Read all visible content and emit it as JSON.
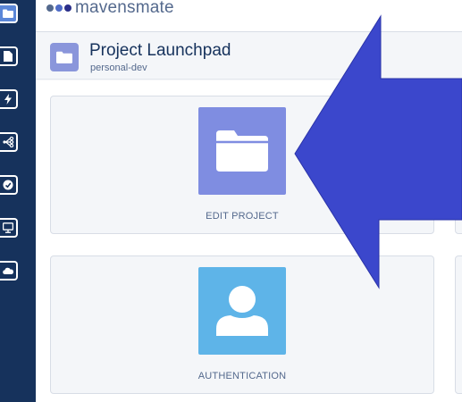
{
  "app": {
    "name": "mavensmate",
    "logo_dot_colors": [
      "#54698d",
      "#4f6cc6",
      "#2a2f8a"
    ]
  },
  "sidebar": {
    "items": [
      {
        "icon": "folder-icon",
        "active": true
      },
      {
        "icon": "document-icon",
        "active": false
      },
      {
        "icon": "lightning-icon",
        "active": false
      },
      {
        "icon": "flow-icon",
        "active": false
      },
      {
        "icon": "gauge-icon",
        "active": false
      },
      {
        "icon": "monitor-icon",
        "active": false
      },
      {
        "icon": "cloud-icon",
        "active": false
      }
    ]
  },
  "header": {
    "title": "Project Launchpad",
    "subtitle": "personal-dev",
    "icon": "folder-icon"
  },
  "cards": [
    {
      "label": "EDIT PROJECT",
      "icon": "folder-icon",
      "color": "#7f8de1"
    },
    {
      "label": "AUTHENTICATION",
      "icon": "user-icon",
      "color": "#5eb4e8"
    }
  ],
  "overlay": {
    "shape": "left-arrow",
    "color": "#3b47cc"
  }
}
